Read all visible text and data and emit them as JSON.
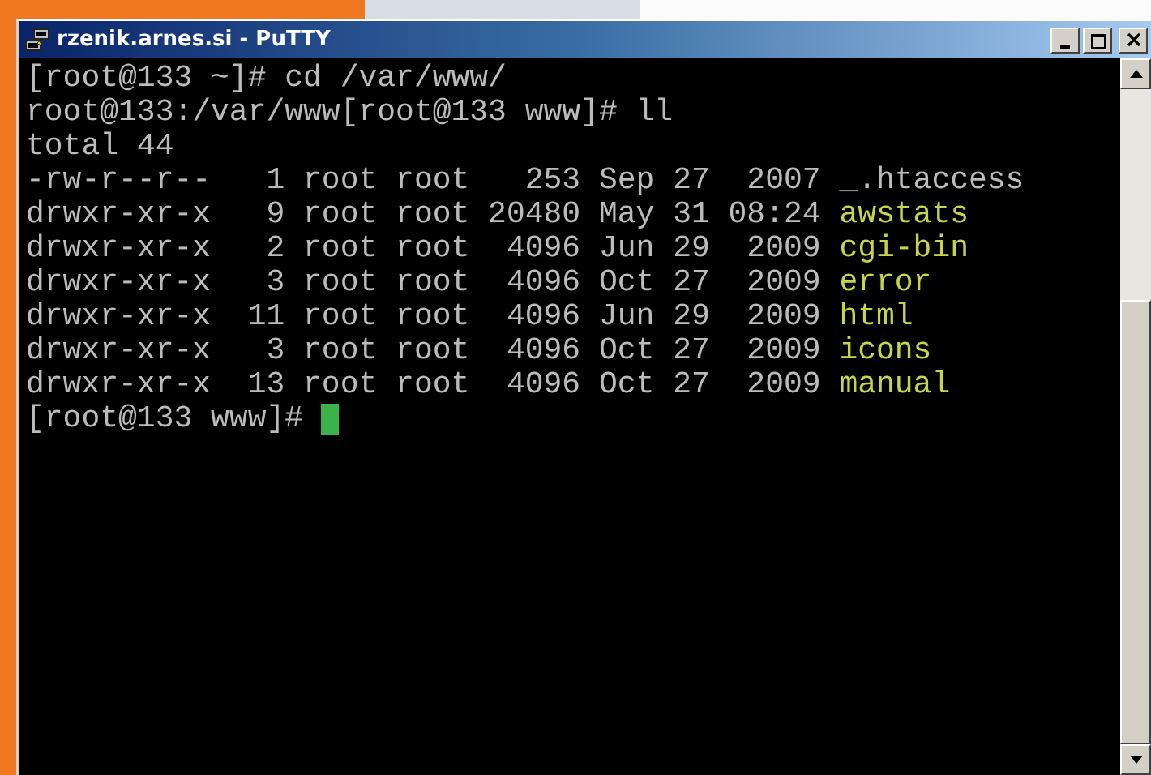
{
  "window": {
    "title": "rzenik.arnes.si - PuTTY"
  },
  "terminal": {
    "lines": [
      {
        "kind": "plain",
        "text": "[root@133 ~]# cd /var/www/"
      },
      {
        "kind": "plain",
        "text": "root@133:/var/www[root@133 www]# ll"
      },
      {
        "kind": "plain",
        "text": "total 44"
      },
      {
        "kind": "file",
        "text": "-rw-r--r--   1 root root   253 Sep 27  2007 ",
        "name": "_.htaccess"
      },
      {
        "kind": "dir",
        "text": "drwxr-xr-x   9 root root 20480 May 31 08:24 ",
        "name": "awstats"
      },
      {
        "kind": "dir",
        "text": "drwxr-xr-x   2 root root  4096 Jun 29  2009 ",
        "name": "cgi-bin"
      },
      {
        "kind": "dir",
        "text": "drwxr-xr-x   3 root root  4096 Oct 27  2009 ",
        "name": "error"
      },
      {
        "kind": "dir",
        "text": "drwxr-xr-x  11 root root  4096 Jun 29  2009 ",
        "name": "html"
      },
      {
        "kind": "dir",
        "text": "drwxr-xr-x   3 root root  4096 Oct 27  2009 ",
        "name": "icons"
      },
      {
        "kind": "dir",
        "text": "drwxr-xr-x  13 root root  4096 Oct 27  2009 ",
        "name": "manual"
      },
      {
        "kind": "prompt",
        "text": "[root@133 www]# ",
        "cursor": true
      }
    ]
  }
}
